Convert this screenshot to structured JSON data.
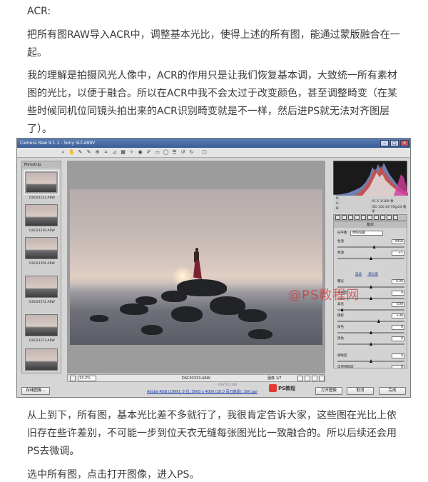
{
  "article": {
    "heading": "ACR:",
    "intro": "把所有图RAW导入ACR中，调整基本光比，使得上述的所有图，能通过蒙版融合在一起。",
    "explanation": "我的理解是拍摄风光人像中，ACR的作用只是让我们恢复基本调，大致统一所有素材图的光比，以便于融合。所以在ACR中我不会太过于改变颜色，甚至调整畸变（在某些时候同机位同镜头拍出来的ACR识别畸变就是不一样，然后进PS就无法对齐图层了）。",
    "after_screenshot": "从上到下，所有图，基本光比差不多就行了，我很肯定告诉大家，这些图在光比上依旧存在些许差别，不可能一步到位天衣无缝每张图光比一致融合的。所以后续还会用PS去微调。",
    "closing": "选中所有图，点击打开图像，进入PS。"
  },
  "acr": {
    "window_title": "Camera Raw 9.1.1 - Sony SLT-A99V",
    "filmstrip_title": "Filmstrip",
    "thumbnails": [
      "DSC03333.ARW",
      "DSC03339.ARW",
      "DSC03356.ARW",
      "DSC03372.ARW",
      "DSC03373.ARW",
      ""
    ],
    "info_rgb": [
      "R:",
      "G:",
      "B:"
    ],
    "info_exif": [
      "f/1.5   1/100 秒",
      "ISO 100   24-70@24 毫米"
    ],
    "panel_title": "基本",
    "white_balance_label": "白平衡",
    "white_balance_value": "原照设置",
    "auto_label": "自动",
    "default_label": "默认值",
    "controls": [
      {
        "label": "色温",
        "value": "4950",
        "knob": 0.55
      },
      {
        "label": "色调",
        "value": "+1",
        "knob": 0.5
      },
      {
        "label": "曝光",
        "value": "0.00",
        "knob": 0.5
      },
      {
        "label": "对比度",
        "value": "0",
        "knob": 0.5
      },
      {
        "label": "高光",
        "value": "-100",
        "knob": 0.05
      },
      {
        "label": "阴影",
        "value": "+38",
        "knob": 0.62
      },
      {
        "label": "白色",
        "value": "0",
        "knob": 0.5
      },
      {
        "label": "黑色",
        "value": "0",
        "knob": 0.5
      },
      {
        "label": "清晰度",
        "value": "0",
        "knob": 0.5
      },
      {
        "label": "自然饱和度",
        "value": "0",
        "knob": 0.5
      },
      {
        "label": "饱和度",
        "value": "0",
        "knob": 0.5
      }
    ],
    "zoom_value": "13.2%",
    "current_file": "DSC03333.ARW",
    "page_indicator": "图像 1/7",
    "workflow_link": "Adobe RGB (1998); 8 位; 5000 x 4000 (20.0 百万像素); 300 ppi",
    "footer_watermark": "FEVTE.COM",
    "save_button": "存储图像...",
    "open_button": "打开图像",
    "cancel_button": "取消",
    "done_button": "完成"
  },
  "watermark": {
    "text": "@PS教程网",
    "logo_text": "PS教程"
  },
  "colors": {
    "accent_titlebar": "#3b5c96",
    "watermark_red": "#d72828",
    "link_blue": "#1a3ab0"
  }
}
